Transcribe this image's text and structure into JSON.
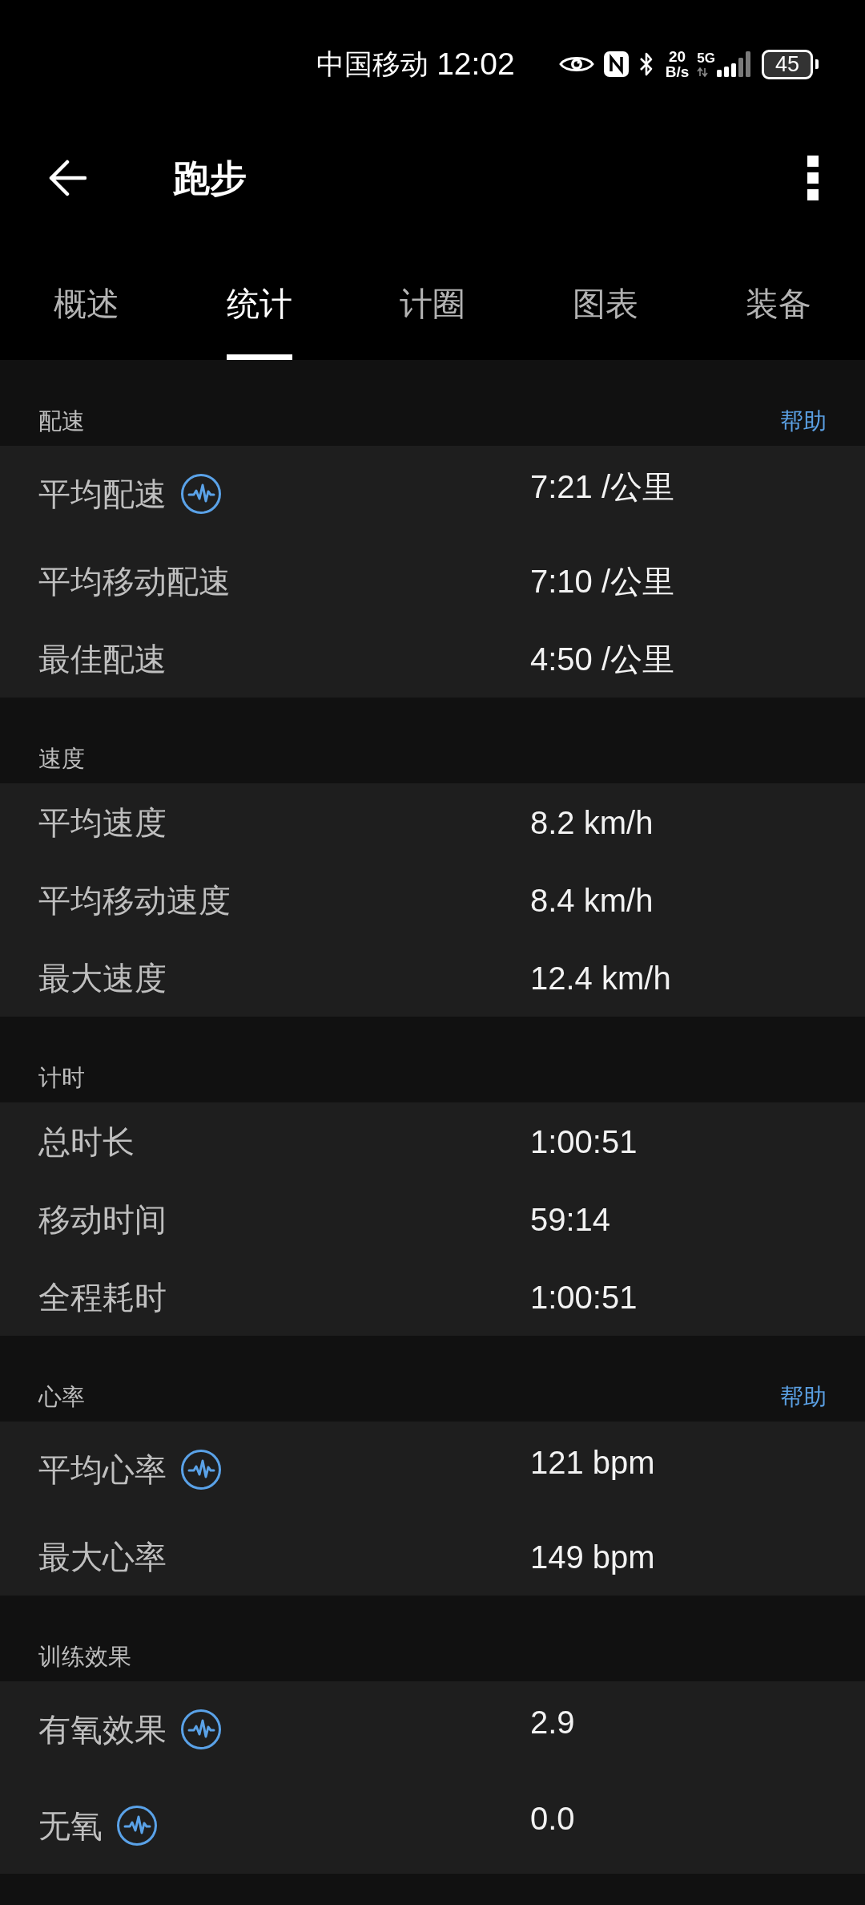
{
  "status_bar": {
    "carrier": "中国移动",
    "time": "12:02",
    "net_speed": "20",
    "net_speed_unit": "B/s",
    "network_type": "5G",
    "battery": "45"
  },
  "app_bar": {
    "title": "跑步"
  },
  "tabs": [
    {
      "label": "概述",
      "selected": false
    },
    {
      "label": "统计",
      "selected": true
    },
    {
      "label": "计圈",
      "selected": false
    },
    {
      "label": "图表",
      "selected": false
    },
    {
      "label": "装备",
      "selected": false
    }
  ],
  "sections": [
    {
      "title": "配速",
      "help": "帮助",
      "rows": [
        {
          "label": "平均配速",
          "value": "7:21 /公里",
          "graph_icon": true
        },
        {
          "label": "平均移动配速",
          "value": "7:10 /公里",
          "graph_icon": false
        },
        {
          "label": "最佳配速",
          "value": "4:50 /公里",
          "graph_icon": false
        }
      ]
    },
    {
      "title": "速度",
      "rows": [
        {
          "label": "平均速度",
          "value": "8.2 km/h",
          "graph_icon": false
        },
        {
          "label": "平均移动速度",
          "value": "8.4 km/h",
          "graph_icon": false
        },
        {
          "label": "最大速度",
          "value": "12.4 km/h",
          "graph_icon": false
        }
      ]
    },
    {
      "title": "计时",
      "rows": [
        {
          "label": "总时长",
          "value": "1:00:51",
          "graph_icon": false
        },
        {
          "label": "移动时间",
          "value": "59:14",
          "graph_icon": false
        },
        {
          "label": "全程耗时",
          "value": "1:00:51",
          "graph_icon": false
        }
      ]
    },
    {
      "title": "心率",
      "help": "帮助",
      "rows": [
        {
          "label": "平均心率",
          "value": "121 bpm",
          "graph_icon": true
        },
        {
          "label": "最大心率",
          "value": "149 bpm",
          "graph_icon": false
        }
      ]
    },
    {
      "title": "训练效果",
      "rows": [
        {
          "label": "有氧效果",
          "value": "2.9",
          "graph_icon": true
        },
        {
          "label": "无氧",
          "value": "0.0",
          "graph_icon": true
        }
      ]
    }
  ]
}
